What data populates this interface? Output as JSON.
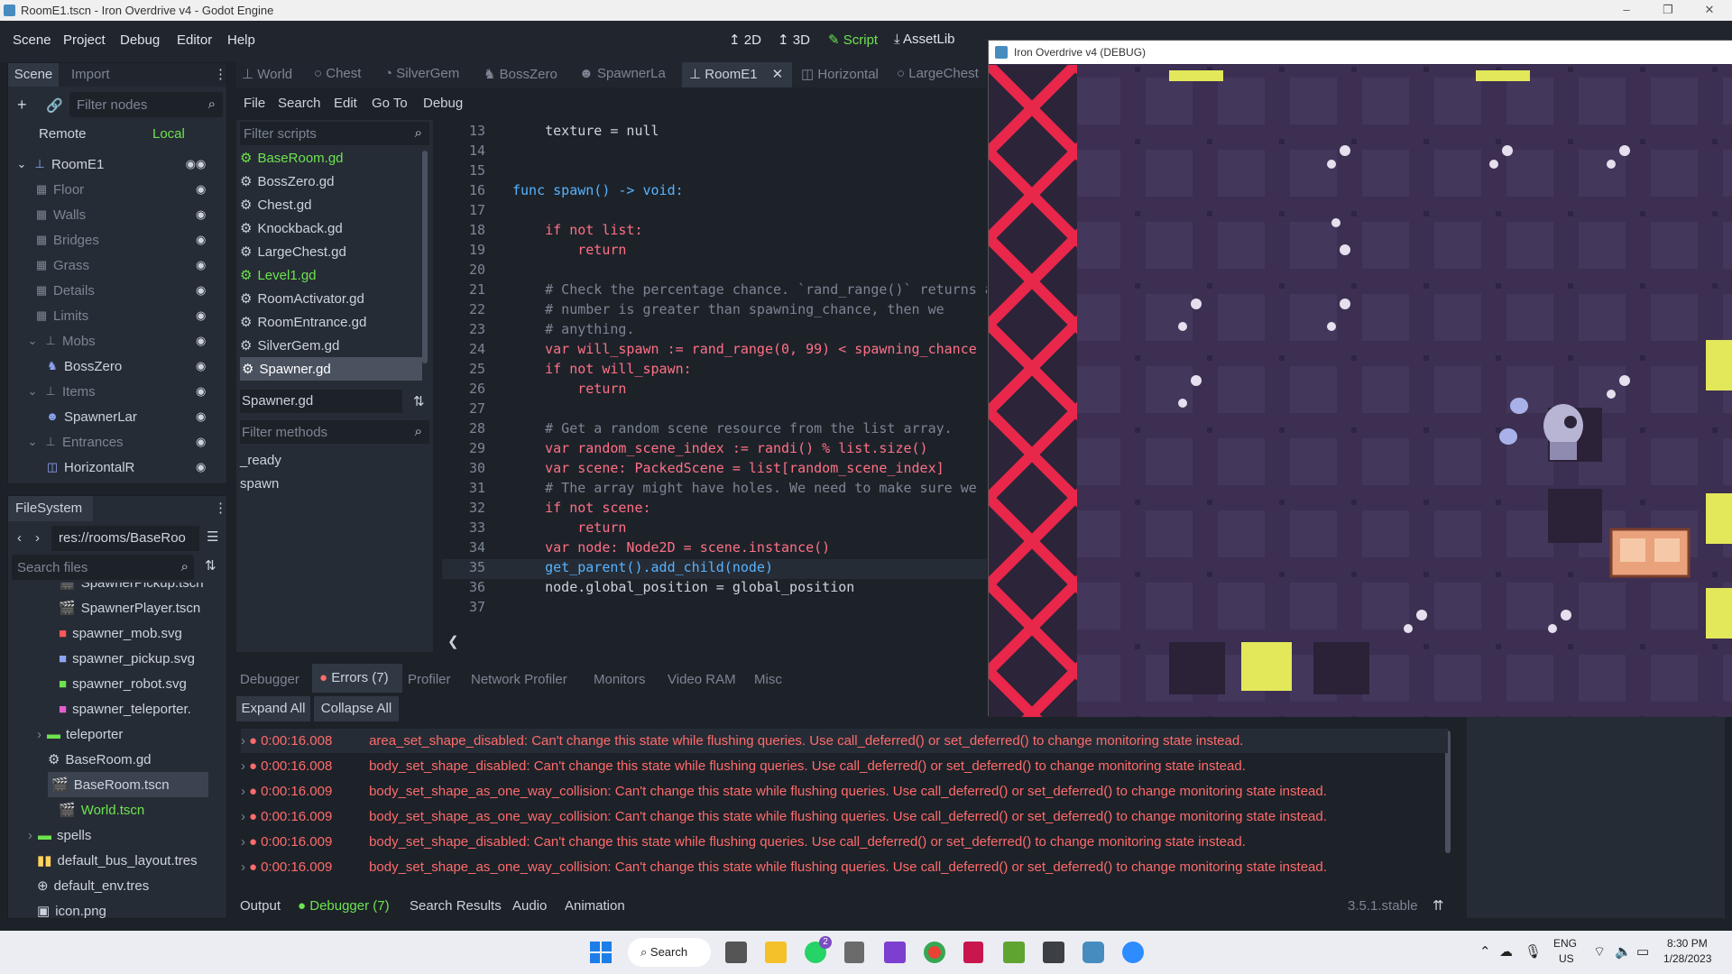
{
  "window": {
    "title": "RoomE1.tscn - Iron Overdrive v4 - Godot Engine",
    "min": "–",
    "max": "❐",
    "close": "✕"
  },
  "menu": [
    "Scene",
    "Project",
    "Debug",
    "Editor",
    "Help"
  ],
  "workspaces": [
    "2D",
    "3D",
    "Script",
    "AssetLib"
  ],
  "scene_dock": {
    "tabs": [
      "Scene",
      "Import"
    ],
    "filter_placeholder": "Filter nodes",
    "remote": "Remote",
    "local": "Local",
    "nodes": [
      "RoomE1",
      "Floor",
      "Walls",
      "Bridges",
      "Grass",
      "Details",
      "Limits",
      "Mobs",
      "BossZero",
      "Items",
      "SpawnerLar",
      "Entrances",
      "HorizontalR"
    ]
  },
  "filesystem": {
    "title": "FileSystem",
    "path": "res://rooms/BaseRoo",
    "search_placeholder": "Search files",
    "items": [
      "SpawnerPickup.tscn",
      "SpawnerPlayer.tscn",
      "spawner_mob.svg",
      "spawner_pickup.svg",
      "spawner_robot.svg",
      "spawner_teleporter.",
      "teleporter",
      "BaseRoom.gd",
      "BaseRoom.tscn",
      "World.tscn",
      "spells",
      "default_bus_layout.tres",
      "default_env.tres",
      "icon.png"
    ]
  },
  "editor_tabs": [
    "World",
    "Chest",
    "SilverGem",
    "BossZero",
    "SpawnerLa",
    "RoomE1",
    "Horizontal",
    "LargeChest"
  ],
  "script_menu": [
    "File",
    "Search",
    "Edit",
    "Go To",
    "Debug"
  ],
  "scripts": {
    "filter_placeholder": "Filter scripts",
    "items": [
      "BaseRoom.gd",
      "BossZero.gd",
      "Chest.gd",
      "Knockback.gd",
      "LargeChest.gd",
      "Level1.gd",
      "RoomActivator.gd",
      "RoomEntrance.gd",
      "SilverGem.gd",
      "Spawner.gd"
    ],
    "current": "Spawner.gd",
    "methods_placeholder": "Filter methods",
    "methods": [
      "_ready",
      "spawn"
    ]
  },
  "code": [
    {
      "n": "13",
      "t": "    texture = null"
    },
    {
      "n": "14",
      "t": ""
    },
    {
      "n": "15",
      "t": ""
    },
    {
      "n": "16",
      "t": "func spawn() -> void:"
    },
    {
      "n": "17",
      "t": ""
    },
    {
      "n": "18",
      "t": "    if not list:"
    },
    {
      "n": "19",
      "t": "        return"
    },
    {
      "n": "20",
      "t": ""
    },
    {
      "n": "21",
      "t": "    # Check the percentage chance. `rand_range()` returns a"
    },
    {
      "n": "22",
      "t": "    # number is greater than spawning_chance, then we"
    },
    {
      "n": "23",
      "t": "    # anything."
    },
    {
      "n": "24",
      "t": "    var will_spawn := rand_range(0, 99) < spawning_chance"
    },
    {
      "n": "25",
      "t": "    if not will_spawn:"
    },
    {
      "n": "26",
      "t": "        return"
    },
    {
      "n": "27",
      "t": ""
    },
    {
      "n": "28",
      "t": "    # Get a random scene resource from the list array."
    },
    {
      "n": "29",
      "t": "    var random_scene_index := randi() % list.size()"
    },
    {
      "n": "30",
      "t": "    var scene: PackedScene = list[random_scene_index]"
    },
    {
      "n": "31",
      "t": "    # The array might have holes. We need to make sure we"
    },
    {
      "n": "32",
      "t": "    if not scene:"
    },
    {
      "n": "33",
      "t": "        return"
    },
    {
      "n": "34",
      "t": "    var node: Node2D = scene.instance()"
    },
    {
      "n": "35",
      "t": "    get_parent().add_child(node)"
    },
    {
      "n": "36",
      "t": "    node.global_position = global_position"
    },
    {
      "n": "37",
      "t": ""
    }
  ],
  "debugger": {
    "tabs": [
      "Debugger",
      "Errors (7)",
      "Profiler",
      "Network Profiler",
      "Monitors",
      "Video RAM",
      "Misc"
    ],
    "expand": "Expand All",
    "collapse": "Collapse All",
    "errors": [
      {
        "time": "0:00:16.008",
        "msg": "area_set_shape_disabled: Can't change this state while flushing queries. Use call_deferred() or set_deferred() to change monitoring state instead."
      },
      {
        "time": "0:00:16.008",
        "msg": "body_set_shape_disabled: Can't change this state while flushing queries. Use call_deferred() or set_deferred() to change monitoring state instead."
      },
      {
        "time": "0:00:16.009",
        "msg": "body_set_shape_as_one_way_collision: Can't change this state while flushing queries. Use call_deferred() or set_deferred() to change monitoring state instead."
      },
      {
        "time": "0:00:16.009",
        "msg": "body_set_shape_as_one_way_collision: Can't change this state while flushing queries. Use call_deferred() or set_deferred() to change monitoring state instead."
      },
      {
        "time": "0:00:16.009",
        "msg": "body_set_shape_disabled: Can't change this state while flushing queries. Use call_deferred() or set_deferred() to change monitoring state instead."
      },
      {
        "time": "0:00:16.009",
        "msg": "body_set_shape_as_one_way_collision: Can't change this state while flushing queries. Use call_deferred() or set_deferred() to change monitoring state instead."
      }
    ]
  },
  "bottom": {
    "tabs": [
      "Output",
      "Debugger (7)",
      "Search Results",
      "Audio",
      "Animation"
    ],
    "version": "3.5.1.stable"
  },
  "game_window": {
    "title": "Iron Overdrive v4 (DEBUG)"
  },
  "taskbar": {
    "search": "Search",
    "lang1": "ENG",
    "lang2": "US",
    "time": "8:30 PM",
    "date": "1/28/2023",
    "badge": "2"
  },
  "colors": {
    "accent": "#6de34f",
    "error": "#ff6b6b",
    "blue": "#57b3ff"
  }
}
